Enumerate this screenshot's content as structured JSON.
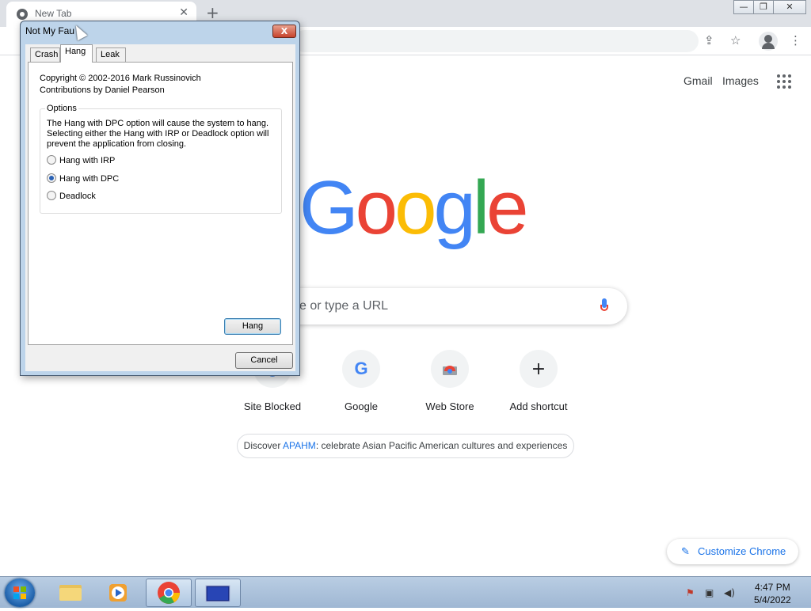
{
  "browser": {
    "tab": {
      "title": "New Tab",
      "close": "✕"
    },
    "new_tab": "+",
    "window_controls": {
      "minimize": "—",
      "restore": "❐",
      "close": "✕"
    },
    "toolbar": {
      "share": "⇪",
      "bookmark": "☆",
      "menu": "⋮"
    }
  },
  "ntp": {
    "gmail": "Gmail",
    "images": "Images",
    "logo_letters": [
      "G",
      "o",
      "o",
      "g",
      "l",
      "e"
    ],
    "logo_colors": [
      "#4285f4",
      "#ea4335",
      "#fbbc05",
      "#4285f4",
      "#34a853",
      "#ea4335"
    ],
    "search_placeholder": "e or type a URL",
    "shortcuts": [
      {
        "label": "Site Blocked",
        "icon": "site-blocked-icon"
      },
      {
        "label": "Google",
        "icon": "G"
      },
      {
        "label": "Web Store",
        "icon": "web-store-icon"
      },
      {
        "label": "Add shortcut",
        "icon": "+"
      }
    ],
    "promo": {
      "prefix": "Discover ",
      "link": "APAHM",
      "suffix": ": celebrate Asian Pacific American cultures and experiences"
    },
    "customize": {
      "icon": "✎",
      "label": "Customize Chrome"
    }
  },
  "dialog": {
    "title": "Not My Fau",
    "close": "X",
    "tabs": [
      "Crash",
      "Hang",
      "Leak"
    ],
    "active_tab": "Hang",
    "copyright": "Copyright © 2002-2016 Mark Russinovich",
    "contributions": "Contributions by Daniel Pearson",
    "options_label": "Options",
    "options_desc": "The Hang with DPC option will cause the system to hang. Selecting either the Hang with IRP or Deadlock option will prevent the application from closing.",
    "radios": [
      {
        "label": "Hang with IRP",
        "checked": false
      },
      {
        "label": "Hang with DPC",
        "checked": true
      },
      {
        "label": "Deadlock",
        "checked": false
      }
    ],
    "hang_button": "Hang",
    "cancel_button": "Cancel"
  },
  "taskbar": {
    "time": "4:47 PM",
    "date": "5/4/2022"
  }
}
